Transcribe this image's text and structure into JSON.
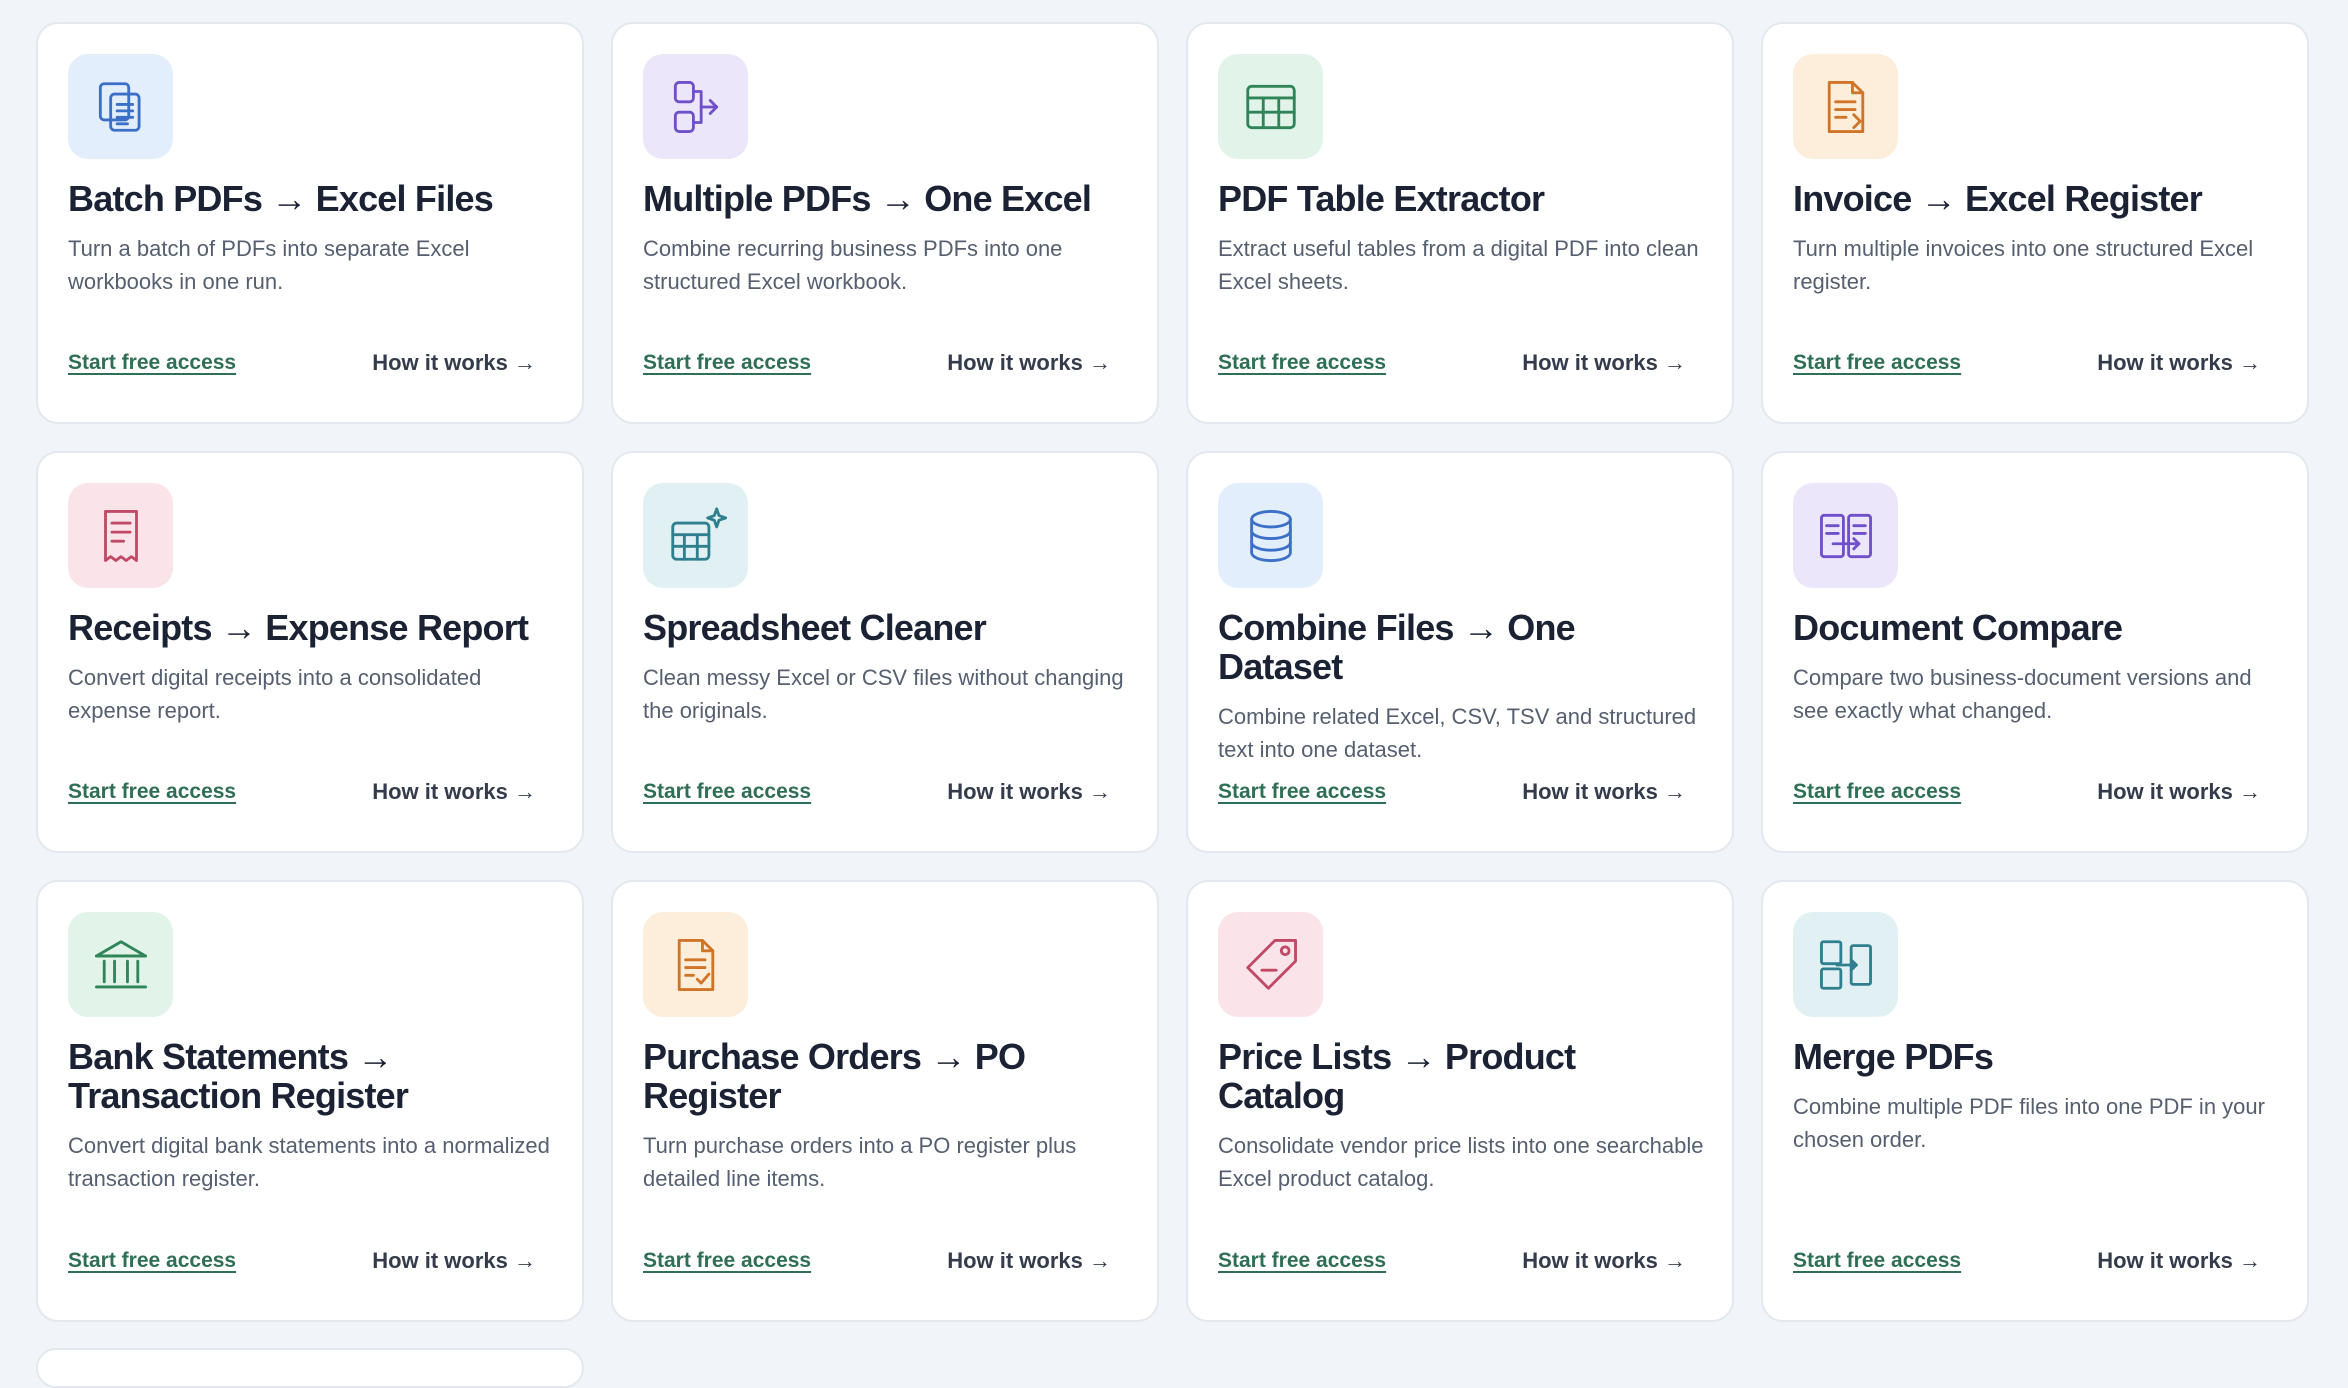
{
  "cards": [
    {
      "title": "Batch PDFs → Excel Files",
      "description": "Turn a batch of PDFs into separate Excel workbooks in one run.",
      "icon": "documents-copy-icon",
      "color": "blue",
      "primary": "Start free access",
      "secondary": "How it works →"
    },
    {
      "title": "Multiple PDFs → One Excel",
      "description": "Combine recurring business PDFs into one structured Excel workbook.",
      "icon": "merge-arrow-icon",
      "color": "purple",
      "primary": "Start free access",
      "secondary": "How it works →"
    },
    {
      "title": "PDF Table Extractor",
      "description": "Extract useful tables from a digital PDF into clean Excel sheets.",
      "icon": "table-icon",
      "color": "green",
      "primary": "Start free access",
      "secondary": "How it works →"
    },
    {
      "title": "Invoice → Excel Register",
      "description": "Turn multiple invoices into one structured Excel register.",
      "icon": "invoice-icon",
      "color": "orange",
      "primary": "Start free access",
      "secondary": "How it works →"
    },
    {
      "title": "Receipts → Expense Report",
      "description": "Convert digital receipts into a consolidated expense report.",
      "icon": "receipt-icon",
      "color": "pink",
      "primary": "Start free access",
      "secondary": "How it works →"
    },
    {
      "title": "Spreadsheet Cleaner",
      "description": "Clean messy Excel or CSV files without changing the originals.",
      "icon": "sparkle-table-icon",
      "color": "teal",
      "primary": "Start free access",
      "secondary": "How it works →"
    },
    {
      "title": "Combine Files → One Dataset",
      "description": "Combine related Excel, CSV, TSV and structured text into one dataset.",
      "icon": "database-icon",
      "color": "blue",
      "primary": "Start free access",
      "secondary": "How it works →"
    },
    {
      "title": "Document Compare",
      "description": "Compare two business-document versions and see exactly what changed.",
      "icon": "compare-icon",
      "color": "purple",
      "primary": "Start free access",
      "secondary": "How it works →"
    },
    {
      "title": "Bank Statements → Transaction Register",
      "description": "Convert digital bank statements into a normalized transaction register.",
      "icon": "bank-icon",
      "color": "green",
      "primary": "Start free access",
      "secondary": "How it works →"
    },
    {
      "title": "Purchase Orders → PO Register",
      "description": "Turn purchase orders into a PO register plus detailed line items.",
      "icon": "purchase-order-icon",
      "color": "orange",
      "primary": "Start free access",
      "secondary": "How it works →"
    },
    {
      "title": "Price Lists → Product Catalog",
      "description": "Consolidate vendor price lists into one searchable Excel product catalog.",
      "icon": "price-tag-icon",
      "color": "pink",
      "primary": "Start free access",
      "secondary": "How it works →"
    },
    {
      "title": "Merge PDFs",
      "description": "Combine multiple PDF files into one PDF in your chosen order.",
      "icon": "merge-pdf-icon",
      "color": "teal",
      "primary": "Start free access",
      "secondary": "How it works →"
    }
  ]
}
